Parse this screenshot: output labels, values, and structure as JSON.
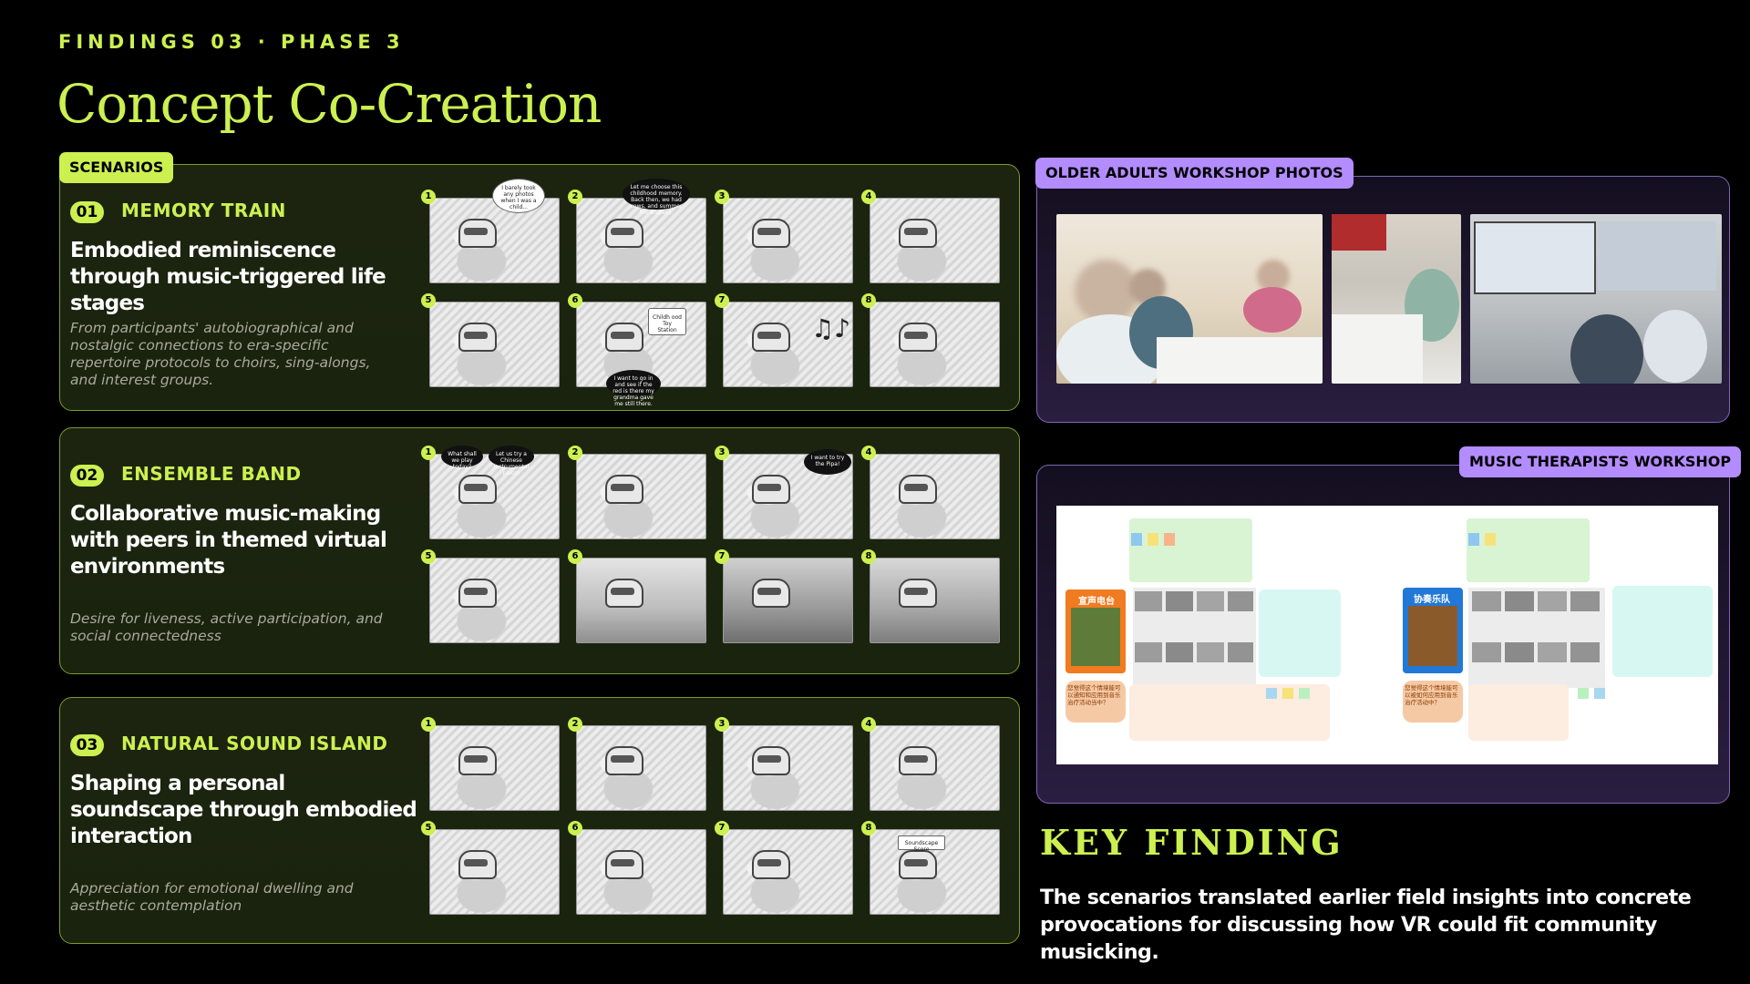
{
  "header": {
    "eyebrow": "FINDINGS 03 · PHASE 3",
    "title": "Concept Co-Creation"
  },
  "scenarios": {
    "tag": "SCENARIOS",
    "items": [
      {
        "number": "01",
        "name": "MEMORY TRAIN",
        "headline": "Embodied reminiscence through music-triggered life stages",
        "description": "From participants' autobiographical and nostalgic connections to era-specific repertoire protocols to choirs, sing-alongs, and interest groups.",
        "panel_numbers": [
          "1",
          "2",
          "3",
          "4",
          "5",
          "6",
          "7",
          "8"
        ],
        "bubbles": {
          "b1": "I barely took any photos when I was a child...",
          "b2": "Let me choose this childhood memory. Back then, we had cows, and summer felt endless.",
          "b3": "Childh ood Toy Station",
          "b4": "I want to go in and see if the red is there my grandma gave me still there."
        }
      },
      {
        "number": "02",
        "name": "ENSEMBLE BAND",
        "headline": "Collaborative music-making with peers in themed virtual environments",
        "description": "Desire for liveness, active participation, and social connectedness",
        "panel_numbers": [
          "1",
          "2",
          "3",
          "4",
          "5",
          "6",
          "7",
          "8"
        ],
        "bubbles": {
          "b1": "What shall we play today?",
          "b2": "Let us try a Chinese instrumental piece!",
          "b3": "I want to try the Pipa!"
        }
      },
      {
        "number": "03",
        "name": "NATURAL SOUND ISLAND",
        "headline": "Shaping a personal soundscape through embodied interaction",
        "description": "Appreciation for emotional dwelling and aesthetic contemplation",
        "panel_numbers": [
          "1",
          "2",
          "3",
          "4",
          "5",
          "6",
          "7",
          "8"
        ],
        "bubbles": {
          "b1": "Soundscape Score"
        }
      }
    ]
  },
  "workshops": {
    "older_adults_tag": "OLDER ADULTS WORKSHOP PHOTOS",
    "therapists_tag": "MUSIC THERAPISTS WORKSHOP",
    "board_labels": {
      "left_title": "宣声电台",
      "right_title": "协奏乐队",
      "left_note": "您觉得这个情境能可以通知和应用到音乐治疗活动当中？",
      "right_note": "您觉得这个情境能可以被如何应用到音乐治疗活动中？"
    }
  },
  "key_finding": {
    "title": "KEY FINDING",
    "body": "The scenarios translated earlier field insights into concrete provocations for discussing how VR could fit community musicking."
  },
  "colors": {
    "accent": "#ccf050",
    "purple": "#b38cff",
    "background": "#000000"
  }
}
